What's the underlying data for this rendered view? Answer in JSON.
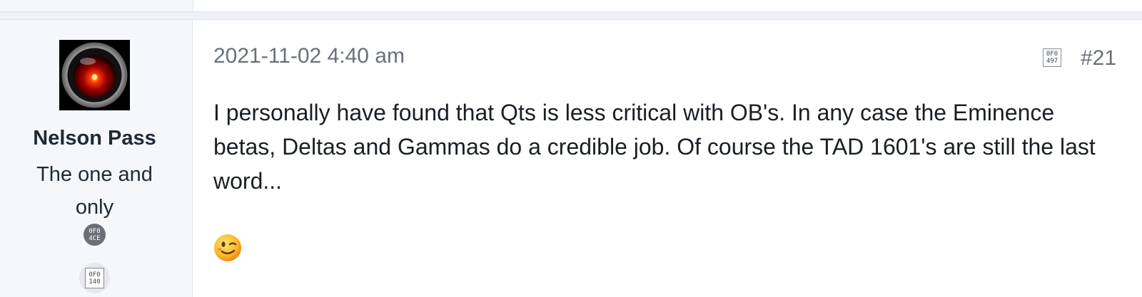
{
  "post": {
    "author": {
      "name": "Nelson Pass",
      "title": "The one and only",
      "badge_1_icon": "0F04CE",
      "badge_2_icon": "0F0140"
    },
    "date": "2021-11-02 4:40 am",
    "share_icon": "0F0497",
    "number": "#21",
    "body": "I personally have found that Qts is less critical with OB's. In any case the Eminence betas, Deltas and Gammas do a credible job. Of course the TAD 1601's are still the last word...",
    "reaction_emoji": "winking-face"
  },
  "colors": {
    "sidebar_bg": "#f5f7fa",
    "border": "#dfe3e8",
    "muted_text": "#6a7079",
    "body_text": "#1a1f26"
  }
}
